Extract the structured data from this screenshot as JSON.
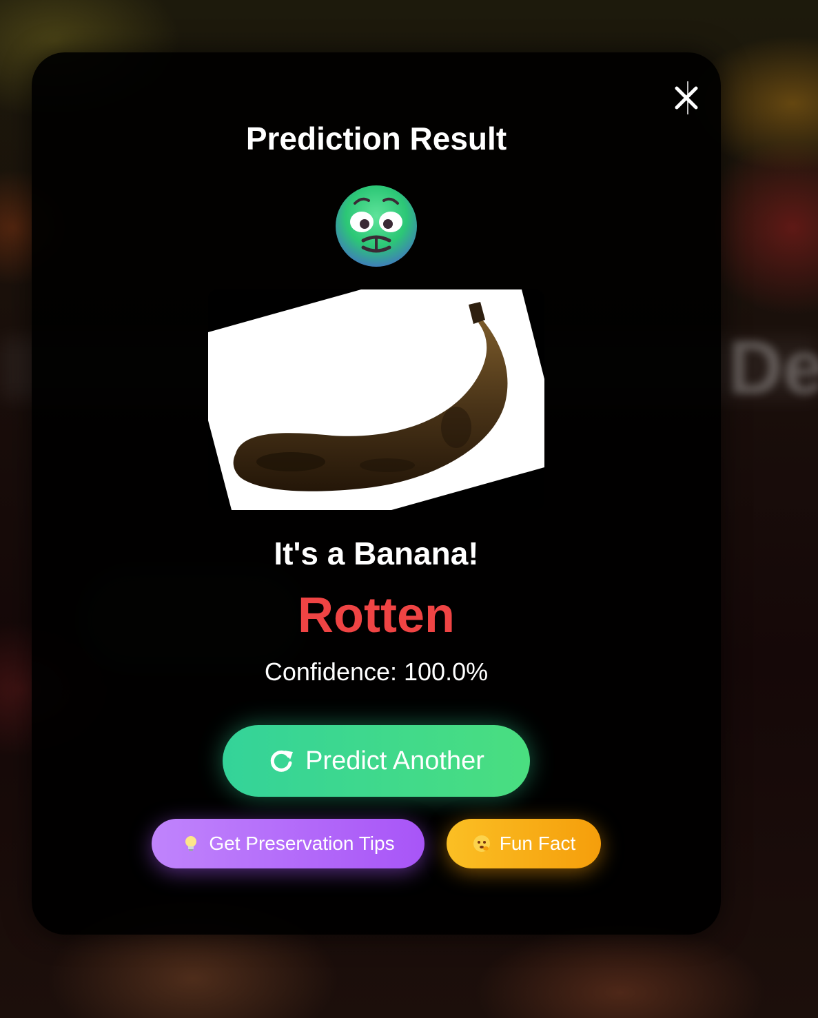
{
  "modal": {
    "title": "Prediction Result",
    "result_face_icon": "nauseated-face-icon",
    "fruit_label": "It's a Banana!",
    "status": "Rotten",
    "status_color": "#ef4444",
    "confidence_text": "Confidence: 100.0%",
    "close_icon": "close-icon"
  },
  "actions": {
    "predict_another_label": "Predict Another",
    "predict_another_icon": "refresh-icon",
    "tips_label": "Get Preservation Tips",
    "tips_icon": "lightbulb-icon",
    "fun_fact_label": "Fun Fact",
    "fun_fact_icon": "thinking-face-icon"
  },
  "colors": {
    "predict_button": "#34d399",
    "tips_button": "#a855f7",
    "fun_fact_button": "#f59e0b"
  }
}
